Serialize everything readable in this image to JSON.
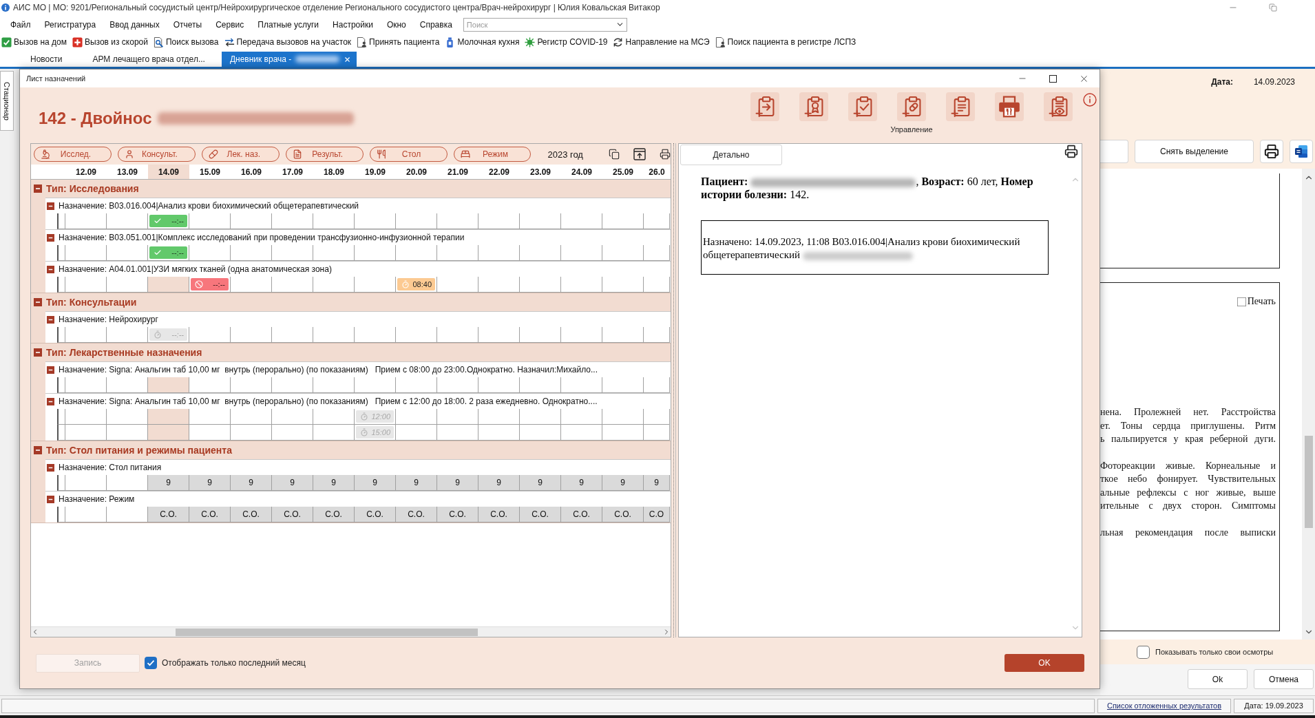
{
  "app_window": {
    "title": "АИС МО | МО: 9201/Региональный сосудистый центр/Нейрохирургическое отделение Регионального сосудистого центра/Врач-нейрохирург | Юлия Ковальская Витакор"
  },
  "menu": [
    "Файл",
    "Регистратура",
    "Ввод данных",
    "Отчеты",
    "Сервис",
    "Платные услуги",
    "Настройки",
    "Окно",
    "Справка"
  ],
  "search": {
    "placeholder": "Поиск"
  },
  "toolbar": [
    "Вызов на дом",
    "Вызов из скорой",
    "Поиск вызова",
    "Передача вызовов на участок",
    "Принять пациента",
    "Молочная кухня",
    "Регистр COVID-19",
    "Направление на МСЭ",
    "Поиск пациента в регистре ЛСПЗ"
  ],
  "tabs": [
    {
      "label": "Новости",
      "selected": false,
      "closable": false,
      "redacted": false
    },
    {
      "label": "АРМ лечащего врача отдел...",
      "selected": false,
      "closable": false,
      "redacted": false
    },
    {
      "label": "Дневник врача -",
      "selected": true,
      "closable": true,
      "redacted": true
    }
  ],
  "side_tab": {
    "label": "Стационар"
  },
  "dialog": {
    "title": "Лист назначений",
    "heading": {
      "text": "142 - Двойнос",
      "redacted": true
    },
    "actions_label": "Управление",
    "filters": [
      "Исслед.",
      "Консульт.",
      "Лек. наз.",
      "Результ.",
      "Стол",
      "Режим"
    ],
    "year": "2023 год",
    "dates": [
      {
        "label": "12.09",
        "selected": false
      },
      {
        "label": "13.09",
        "selected": false
      },
      {
        "label": "14.09",
        "selected": true
      },
      {
        "label": "15.09",
        "selected": false
      },
      {
        "label": "16.09",
        "selected": false
      },
      {
        "label": "17.09",
        "selected": false
      },
      {
        "label": "18.09",
        "selected": false
      },
      {
        "label": "19.09",
        "selected": false
      },
      {
        "label": "20.09",
        "selected": false
      },
      {
        "label": "21.09",
        "selected": false
      },
      {
        "label": "22.09",
        "selected": false
      },
      {
        "label": "23.09",
        "selected": false
      },
      {
        "label": "24.09",
        "selected": false
      },
      {
        "label": "25.09",
        "selected": false
      },
      {
        "label": "26.0",
        "selected": false
      }
    ],
    "groups": [
      {
        "title": "Тип: Исследования",
        "expanded": true,
        "items": [
          {
            "title": "Назначение: B03.016.004|Анализ крови биохимический общетерапевтический",
            "expanded": true,
            "rows": [
              {
                "cells": [
                  {
                    "kind": "blank"
                  },
                  {
                    "kind": "blank"
                  },
                  {
                    "kind": "done",
                    "time": "--:--"
                  },
                  {
                    "kind": "blank"
                  },
                  {
                    "kind": "blank"
                  },
                  {
                    "kind": "blank"
                  },
                  {
                    "kind": "blank"
                  },
                  {
                    "kind": "blank"
                  },
                  {
                    "kind": "blank"
                  },
                  {
                    "kind": "blank"
                  },
                  {
                    "kind": "blank"
                  },
                  {
                    "kind": "blank"
                  },
                  {
                    "kind": "blank"
                  },
                  {
                    "kind": "blank"
                  },
                  {
                    "kind": "blank"
                  }
                ]
              }
            ]
          },
          {
            "title": "Назначение: B03.051.001|Комплекс исследований при проведении трансфузионно-инфузионной терапии",
            "expanded": true,
            "rows": [
              {
                "cells": [
                  {
                    "kind": "blank"
                  },
                  {
                    "kind": "blank"
                  },
                  {
                    "kind": "done",
                    "time": "--:--"
                  },
                  {
                    "kind": "blank"
                  },
                  {
                    "kind": "blank"
                  },
                  {
                    "kind": "blank"
                  },
                  {
                    "kind": "blank"
                  },
                  {
                    "kind": "blank"
                  },
                  {
                    "kind": "blank"
                  },
                  {
                    "kind": "blank"
                  },
                  {
                    "kind": "blank"
                  },
                  {
                    "kind": "blank"
                  },
                  {
                    "kind": "blank"
                  },
                  {
                    "kind": "blank"
                  },
                  {
                    "kind": "blank"
                  }
                ]
              }
            ]
          },
          {
            "title": "Назначение: A04.01.001|УЗИ мягких тканей (одна анатомическая зона)",
            "expanded": true,
            "rows": [
              {
                "cells": [
                  {
                    "kind": "blank"
                  },
                  {
                    "kind": "blank"
                  },
                  {
                    "kind": "blank"
                  },
                  {
                    "kind": "cancelled",
                    "time": "--:--"
                  },
                  {
                    "kind": "blank"
                  },
                  {
                    "kind": "blank"
                  },
                  {
                    "kind": "blank"
                  },
                  {
                    "kind": "blank"
                  },
                  {
                    "kind": "planned",
                    "time": "08:40"
                  },
                  {
                    "kind": "blank"
                  },
                  {
                    "kind": "blank"
                  },
                  {
                    "kind": "blank"
                  },
                  {
                    "kind": "blank"
                  },
                  {
                    "kind": "blank"
                  },
                  {
                    "kind": "blank"
                  }
                ]
              }
            ]
          }
        ]
      },
      {
        "title": "Тип: Консультации",
        "expanded": true,
        "items": [
          {
            "title": "Назначение: Нейрохирург",
            "expanded": true,
            "rows": [
              {
                "cells": [
                  {
                    "kind": "blank"
                  },
                  {
                    "kind": "blank"
                  },
                  {
                    "kind": "pending",
                    "time": "--:--"
                  },
                  {
                    "kind": "blank"
                  },
                  {
                    "kind": "blank"
                  },
                  {
                    "kind": "blank"
                  },
                  {
                    "kind": "blank"
                  },
                  {
                    "kind": "blank"
                  },
                  {
                    "kind": "blank"
                  },
                  {
                    "kind": "blank"
                  },
                  {
                    "kind": "blank"
                  },
                  {
                    "kind": "blank"
                  },
                  {
                    "kind": "blank"
                  },
                  {
                    "kind": "blank"
                  },
                  {
                    "kind": "blank"
                  }
                ]
              }
            ]
          }
        ]
      },
      {
        "title": "Тип: Лекарственные назначения",
        "expanded": true,
        "items": [
          {
            "title": "Назначение: Signa: Анальгин таб 10,00 мг  внутрь (перорально) (по показаниям)   Прием с 08:00 до 23:00.Однократно. Назначил:Михайло...",
            "expanded": true,
            "rows": [
              {
                "cells": [
                  {
                    "kind": "blank"
                  },
                  {
                    "kind": "blank"
                  },
                  {
                    "kind": "blank"
                  },
                  {
                    "kind": "blank"
                  },
                  {
                    "kind": "blank"
                  },
                  {
                    "kind": "blank"
                  },
                  {
                    "kind": "blank"
                  },
                  {
                    "kind": "blank"
                  },
                  {
                    "kind": "blank"
                  },
                  {
                    "kind": "blank"
                  },
                  {
                    "kind": "blank"
                  },
                  {
                    "kind": "blank"
                  },
                  {
                    "kind": "blank"
                  },
                  {
                    "kind": "blank"
                  },
                  {
                    "kind": "blank"
                  }
                ]
              }
            ]
          },
          {
            "title": "Назначение: Signa: Анальгин таб 10,00 мг  внутрь (перорально) (по показаниям)   Прием с 12:00 до 18:00. 2 раза ежедневно. Однократно....",
            "expanded": true,
            "rows": [
              {
                "cells": [
                  {
                    "kind": "blank"
                  },
                  {
                    "kind": "blank"
                  },
                  {
                    "kind": "blank"
                  },
                  {
                    "kind": "blank"
                  },
                  {
                    "kind": "blank"
                  },
                  {
                    "kind": "blank"
                  },
                  {
                    "kind": "blank"
                  },
                  {
                    "kind": "pending",
                    "time": "12:00"
                  },
                  {
                    "kind": "blank"
                  },
                  {
                    "kind": "blank"
                  },
                  {
                    "kind": "blank"
                  },
                  {
                    "kind": "blank"
                  },
                  {
                    "kind": "blank"
                  },
                  {
                    "kind": "blank"
                  },
                  {
                    "kind": "blank"
                  }
                ]
              },
              {
                "cells": [
                  {
                    "kind": "blank"
                  },
                  {
                    "kind": "blank"
                  },
                  {
                    "kind": "blank"
                  },
                  {
                    "kind": "blank"
                  },
                  {
                    "kind": "blank"
                  },
                  {
                    "kind": "blank"
                  },
                  {
                    "kind": "blank"
                  },
                  {
                    "kind": "pending",
                    "time": "15:00"
                  },
                  {
                    "kind": "blank"
                  },
                  {
                    "kind": "blank"
                  },
                  {
                    "kind": "blank"
                  },
                  {
                    "kind": "blank"
                  },
                  {
                    "kind": "blank"
                  },
                  {
                    "kind": "blank"
                  },
                  {
                    "kind": "blank"
                  }
                ]
              }
            ]
          }
        ]
      },
      {
        "title": "Тип: Стол питания и режимы пациента",
        "expanded": true,
        "items": [
          {
            "title": "Назначение: Стол питания",
            "expanded": true,
            "rows": [
              {
                "cells": [
                  {
                    "kind": "blank"
                  },
                  {
                    "kind": "blank"
                  },
                  {
                    "kind": "value",
                    "text": "9"
                  },
                  {
                    "kind": "value",
                    "text": "9"
                  },
                  {
                    "kind": "value",
                    "text": "9"
                  },
                  {
                    "kind": "value",
                    "text": "9"
                  },
                  {
                    "kind": "value",
                    "text": "9"
                  },
                  {
                    "kind": "value",
                    "text": "9"
                  },
                  {
                    "kind": "value",
                    "text": "9"
                  },
                  {
                    "kind": "value",
                    "text": "9"
                  },
                  {
                    "kind": "value",
                    "text": "9"
                  },
                  {
                    "kind": "value",
                    "text": "9"
                  },
                  {
                    "kind": "value",
                    "text": "9"
                  },
                  {
                    "kind": "value",
                    "text": "9"
                  },
                  {
                    "kind": "value",
                    "text": "9"
                  }
                ]
              }
            ]
          },
          {
            "title": "Назначение: Режим",
            "expanded": true,
            "rows": [
              {
                "cells": [
                  {
                    "kind": "blank"
                  },
                  {
                    "kind": "blank"
                  },
                  {
                    "kind": "value",
                    "text": "С.О."
                  },
                  {
                    "kind": "value",
                    "text": "С.О."
                  },
                  {
                    "kind": "value",
                    "text": "С.О."
                  },
                  {
                    "kind": "value",
                    "text": "С.О."
                  },
                  {
                    "kind": "value",
                    "text": "С.О."
                  },
                  {
                    "kind": "value",
                    "text": "С.О."
                  },
                  {
                    "kind": "value",
                    "text": "С.О."
                  },
                  {
                    "kind": "value",
                    "text": "С.О."
                  },
                  {
                    "kind": "value",
                    "text": "С.О."
                  },
                  {
                    "kind": "value",
                    "text": "С.О."
                  },
                  {
                    "kind": "value",
                    "text": "С.О."
                  },
                  {
                    "kind": "value",
                    "text": "С.О."
                  },
                  {
                    "kind": "value",
                    "text": "С.О"
                  }
                ]
              }
            ]
          }
        ]
      }
    ],
    "detail": {
      "tab": "Детально",
      "summary": {
        "lead": "**Пациент:**",
        "rest": ", **Возраст:** 60 лет, **Номер истории болезни:** 142.",
        "redacted": true
      },
      "entry": {
        "text": "Назначено: 14.09.2023, 11:08 B03.016.004|Анализ крови биохимический общетерапевтический",
        "redacted": true
      }
    },
    "record_button": {
      "label": "Запись",
      "disabled": true
    },
    "last_month": {
      "label": "Отображать только последний месяц",
      "checked": true
    },
    "ok_button": "OK"
  },
  "form": {
    "date_label": "Дата:",
    "date": "14.09.2023",
    "clear_button": "Снять выделение",
    "print_option": {
      "label": "Печать",
      "checked": false
    },
    "paragraphs": [
      [
        "нена. Пролежней нет. Расстройства",
        "ет. Тоны сердца приглушены. Ритм",
        "ь пальпируется у края реберной дуги."
      ],
      [
        "Фотореакции живые. Корнеальные и",
        "ткое небо фонирует. Чувствительных",
        "альные рефлексы с ног живые, выше",
        "ительные с двух сторон. Симптомы"
      ],
      [
        "льная рекомендация после выписки"
      ]
    ],
    "own_only": {
      "label": "Показывать только свои осмотры",
      "checked": false
    },
    "buttons": [
      "Ok",
      "Отмена"
    ]
  },
  "status_bar": {
    "link": "Список отложенных результатов",
    "date": "Дата: 19.09.2023"
  }
}
